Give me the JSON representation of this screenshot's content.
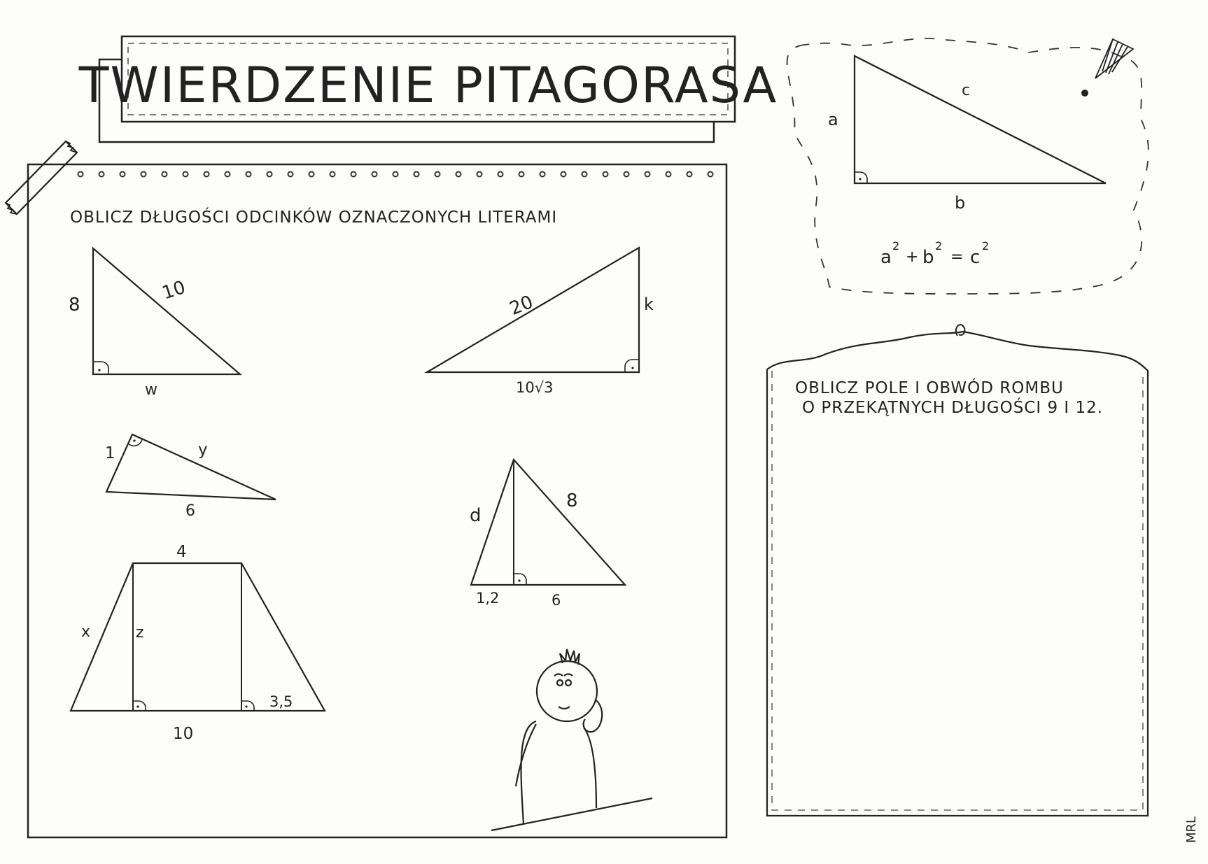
{
  "title": "TWIERDZENIE PITAGORASA",
  "left_panel": {
    "instruction": "OBLICZ DŁUGOŚCI ODCINKÓW OZNACZONYCH LITERAMI",
    "triangle1": {
      "leg_vertical": "8",
      "hypotenuse": "10",
      "base": "w"
    },
    "triangle2": {
      "hypotenuse": "20",
      "leg_vertical": "k",
      "base": "10√3"
    },
    "triangle3": {
      "short_leg": "1",
      "long_leg": "y",
      "hypotenuse": "6"
    },
    "triangle4": {
      "left_side": "d",
      "right_side": "8",
      "left_base": "1,2",
      "right_base": "6"
    },
    "trapezoid": {
      "top": "4",
      "slant": "x",
      "height": "z",
      "right_overhang": "3,5",
      "bottom": "10"
    }
  },
  "reference": {
    "side_a": "a",
    "side_b": "b",
    "side_c": "c",
    "formula_a": "a",
    "formula_b": "b",
    "formula_c": "c",
    "formula_exp": "2",
    "formula_plus": "+",
    "formula_eq": "="
  },
  "right_panel": {
    "task_line1": "OBLICZ POLE I OBWÓD ROMBU",
    "task_line2": "O PRZEKĄTNYCH DŁUGOŚCI 9 I 12."
  },
  "signature": "MRL"
}
